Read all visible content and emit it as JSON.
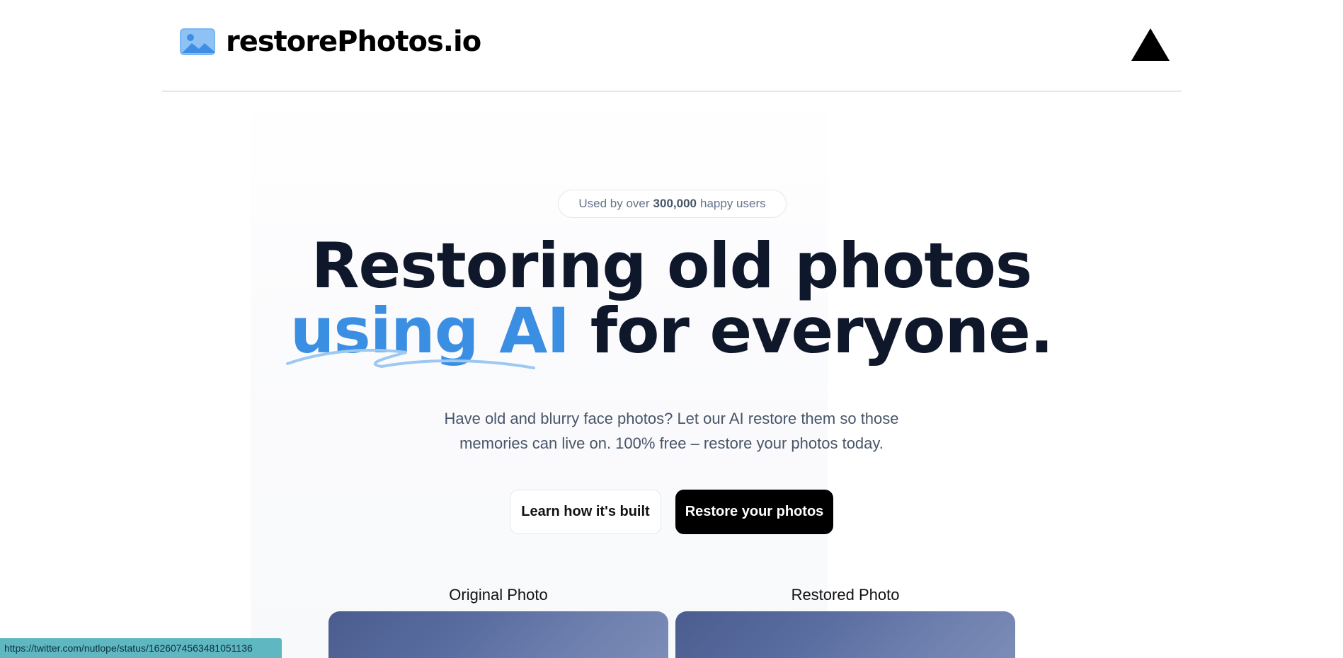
{
  "header": {
    "logo_text": "restorePhotos.io"
  },
  "hero": {
    "badge_prefix": "Used by over",
    "badge_count": "300,000",
    "badge_suffix": "happy users",
    "headline_line1": "Restoring old photos",
    "headline_highlight": "using AI",
    "headline_rest": "for everyone.",
    "subtitle": "Have old and blurry face photos? Let our AI restore them so those memories can live on. 100% free – restore your photos today.",
    "learn_button": "Learn how it's built",
    "restore_button": "Restore your photos"
  },
  "photos": {
    "original_label": "Original Photo",
    "restored_label": "Restored Photo"
  },
  "status_bar": {
    "url": "https://twitter.com/nutlope/status/1626074563481051136"
  },
  "colors": {
    "accent": "#3b8fe3",
    "text_dark": "#0f172a",
    "button_dark": "#000000",
    "status_bar": "#5fb7c2"
  },
  "icons": [
    "photo-logo-icon",
    "vercel-triangle-icon"
  ]
}
